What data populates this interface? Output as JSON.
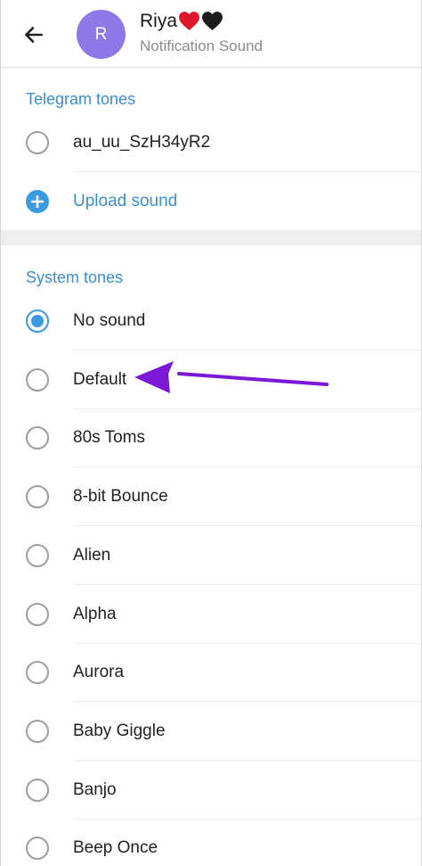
{
  "header": {
    "back_icon": "arrow-left-icon",
    "avatar_initial": "R",
    "name": "Riya",
    "name_emoji": [
      "red-heart-icon",
      "black-heart-icon"
    ],
    "subtitle": "Notification Sound"
  },
  "telegram_tones": {
    "title": "Telegram tones",
    "items": [
      {
        "label": "au_uu_SzH34yR2",
        "selected": false
      }
    ],
    "upload_label": "Upload sound"
  },
  "system_tones": {
    "title": "System tones",
    "items": [
      {
        "label": "No sound",
        "selected": true
      },
      {
        "label": "Default",
        "selected": false
      },
      {
        "label": "80s Toms",
        "selected": false
      },
      {
        "label": "8-bit Bounce",
        "selected": false
      },
      {
        "label": "Alien",
        "selected": false
      },
      {
        "label": "Alpha",
        "selected": false
      },
      {
        "label": "Aurora",
        "selected": false
      },
      {
        "label": "Baby Giggle",
        "selected": false
      },
      {
        "label": "Banjo",
        "selected": false
      },
      {
        "label": "Beep Once",
        "selected": false
      }
    ]
  },
  "colors": {
    "accent": "#3a9be0",
    "section_title": "#3a8fd0",
    "avatar": "#8f79e6",
    "annotation_arrow": "#7a18d6"
  }
}
